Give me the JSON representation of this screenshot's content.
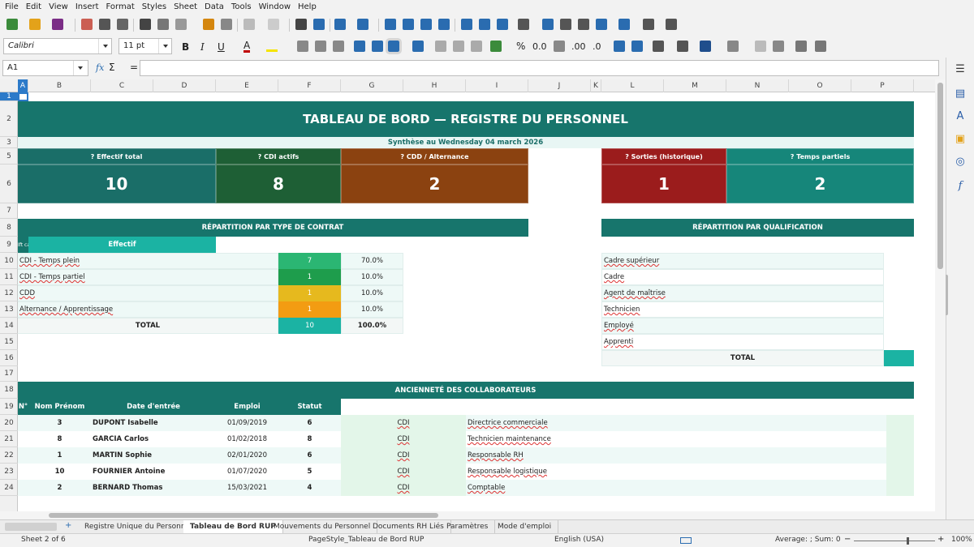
{
  "menu": [
    "File",
    "Edit",
    "View",
    "Insert",
    "Format",
    "Styles",
    "Sheet",
    "Data",
    "Tools",
    "Window",
    "Help"
  ],
  "font": {
    "name": "Calibri",
    "size": "11 pt"
  },
  "namebox": "A1",
  "formula_symbols": {
    "fx": "fx",
    "sum": "Σ",
    "eq": "="
  },
  "columns": [
    "A",
    "B",
    "C",
    "D",
    "E",
    "F",
    "G",
    "H",
    "I",
    "J",
    "K",
    "L",
    "M",
    "N",
    "O",
    "P"
  ],
  "rows": [
    "1",
    "2",
    "3",
    "5",
    "6",
    "7",
    "8",
    "9",
    "10",
    "11",
    "12",
    "13",
    "14",
    "15",
    "16",
    "17",
    "18",
    "19",
    "20",
    "21",
    "22",
    "23",
    "24"
  ],
  "dashboard": {
    "title": "TABLEAU DE BORD — REGISTRE DU PERSONNEL",
    "subtitle": "Synthèse au Wednesday 04 march 2026",
    "kpis": [
      {
        "label": "? Effectif total",
        "value": "10",
        "color": "#1a6e68"
      },
      {
        "label": "? CDI actifs",
        "value": "8",
        "color": "#1e5f35"
      },
      {
        "label": "? CDD / Alternance",
        "value": "2",
        "color": "#8b4210"
      },
      {
        "label": "? Sorties (historique)",
        "value": "1",
        "color": "#9b1c1c"
      },
      {
        "label": "? Temps partiels",
        "value": "2",
        "color": "#16867a"
      }
    ],
    "contract_section": {
      "title": "RÉPARTITION PAR TYPE DE CONTRAT",
      "header_a": "Ift ca",
      "header_effectif": "Effectif",
      "rows": [
        {
          "label": "CDI - Temps plein",
          "count": "7",
          "pct": "70.0%",
          "color": "#2bb673"
        },
        {
          "label": "CDI - Temps partiel",
          "count": "1",
          "pct": "10.0%",
          "color": "#1e9d4c"
        },
        {
          "label": "CDD",
          "count": "1",
          "pct": "10.0%",
          "color": "#e6b91e"
        },
        {
          "label": "Alternance / Apprentissage",
          "count": "1",
          "pct": "10.0%",
          "color": "#f39c12"
        }
      ],
      "total_label": "TOTAL",
      "total_count": "10",
      "total_pct": "100.0%"
    },
    "qualification_section": {
      "title": "RÉPARTITION PAR QUALIFICATION",
      "rows": [
        "Cadre supérieur",
        "Cadre",
        "Agent de maîtrise",
        "Technicien",
        "Employé",
        "Apprenti"
      ],
      "total_label": "TOTAL"
    },
    "seniority_section": {
      "title": "ANCIENNETÉ DES COLLABORATEURS",
      "headers": [
        "N°",
        "Nom Prénom",
        "Date d'entrée",
        "Emploi",
        "Statut"
      ],
      "rows": [
        {
          "n": "3",
          "name": "DUPONT Isabelle",
          "date": "01/09/2019",
          "years": "6",
          "contract": "CDI",
          "job": "Directrice commerciale"
        },
        {
          "n": "8",
          "name": "GARCIA Carlos",
          "date": "01/02/2018",
          "years": "8",
          "contract": "CDI",
          "job": "Technicien maintenance"
        },
        {
          "n": "1",
          "name": "MARTIN Sophie",
          "date": "02/01/2020",
          "years": "6",
          "contract": "CDI",
          "job": "Responsable RH"
        },
        {
          "n": "10",
          "name": "FOURNIER Antoine",
          "date": "01/07/2020",
          "years": "5",
          "contract": "CDI",
          "job": "Responsable logistique"
        },
        {
          "n": "2",
          "name": "BERNARD Thomas",
          "date": "15/03/2021",
          "years": "4",
          "contract": "CDI",
          "job": "Comptable"
        }
      ]
    }
  },
  "sheet_tabs": [
    "Registre Unique du Personnel",
    "Tableau de Bord RUP",
    "Mouvements du Personnel",
    "Documents RH Liés",
    "Paramètres",
    "Mode d'emploi"
  ],
  "active_tab": "Tableau de Bord RUP",
  "status": {
    "sheet": "Sheet 2 of 6",
    "page_style": "PageStyle_Tableau de Bord RUP",
    "language": "English (USA)",
    "summary": "Average: ; Sum: 0",
    "zoom": "100%"
  },
  "colors": {
    "teal_dark": "#17756c",
    "teal": "#1bb3a3",
    "row_light": "#eef9f7",
    "green_light": "#e3f6e9"
  }
}
